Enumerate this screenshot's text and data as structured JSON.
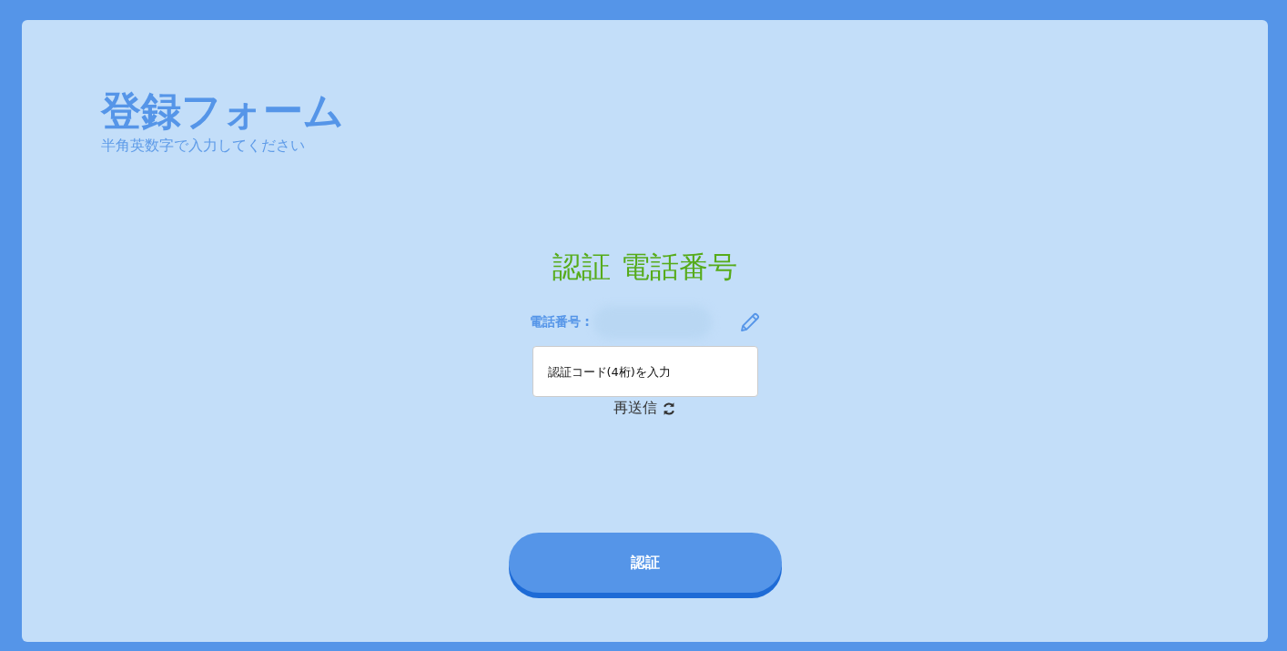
{
  "header": {
    "title": "登録フォーム",
    "subtitle": "半角英数字で入力してください"
  },
  "verify": {
    "heading": "認証 電話番号",
    "phone_label": "電話番号 :",
    "code_field": {
      "placeholder": "認証コード(4桁)を入力"
    },
    "resend": "再送信"
  },
  "submit_button": "認証"
}
